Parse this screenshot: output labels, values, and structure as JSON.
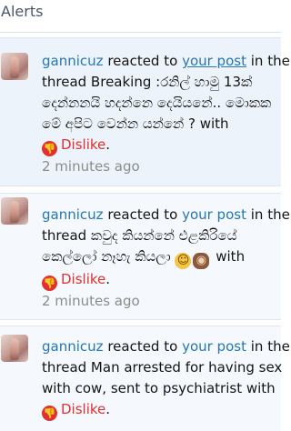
{
  "header": {
    "title": "Alerts"
  },
  "alerts": [
    {
      "user": "gannicuz",
      "reacted_text": "reacted to",
      "post_label": "your post",
      "in_text": "in the",
      "thread_lines": [
        "thread Breaking :රනිල් හාමු 13ක්",
        "දෙන්නනයි හදන්නෙ දෙයියනේ.. මොකක",
        "මේ අපිට වෙන්න යන්නේ ? with"
      ],
      "reaction": "Dislike",
      "reaction_suffix": ".",
      "time": "2 minutes ago"
    },
    {
      "user": "gannicuz",
      "reacted_text": "reacted to",
      "post_label": "your post",
      "in_text": "in the",
      "thread_lines": [
        "thread කවුද කියන්නේ එළකිරියේ",
        "කෙල්ලෝ නෑහැ කියලා",
        "with"
      ],
      "emojis": [
        "grinning-face-emoji",
        "see-no-evil-monkey-emoji"
      ],
      "reaction": "Dislike",
      "reaction_suffix": ".",
      "time": "2 minutes ago"
    },
    {
      "user": "gannicuz",
      "reacted_text": "reacted to",
      "post_label": "your post",
      "in_text": "in the",
      "thread_lines": [
        "thread Man arrested for having sex",
        "with cow, sent to psychiatrist with"
      ],
      "reaction": "Dislike",
      "reaction_suffix": "."
    }
  ],
  "colors": {
    "link": "#2577b1",
    "dislike": "#e03030",
    "muted": "#8c8c8c"
  }
}
